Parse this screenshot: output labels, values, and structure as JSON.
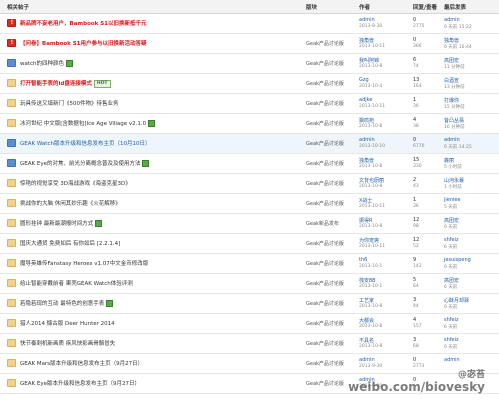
{
  "header": {
    "title": "相关帖子",
    "col_board": "版块",
    "col_author": "作者",
    "col_stats": "回复/查看",
    "col_last": "最后发表"
  },
  "rows": [
    {
      "title": "新品牌不妄老用户，Bambook S1以旧换新抵千元",
      "style": "red",
      "icon": "alert",
      "badge": "",
      "board": "",
      "author": "admin",
      "adate": "2013-8-30",
      "replies": "0",
      "views": "2775",
      "lastuser": "admin",
      "lasttime": "6 天前 15:22"
    },
    {
      "title": "【问卷】Bambook S1用户参与以旧换新活动答疑",
      "style": "red",
      "icon": "alert",
      "badge": "",
      "board": "Geak产品讨论版",
      "author": "独角兽",
      "adate": "2013-10-11",
      "replies": "0",
      "views": "366",
      "lastuser": "独角兽",
      "lasttime": "6 天前 16:44"
    },
    {
      "title": "watch的四种颜色",
      "style": "",
      "icon": "blue",
      "badge": "sq",
      "board": "Geak产品讨论版",
      "author": "我叫阿锦",
      "adate": "2013-10-8",
      "replies": "6",
      "views": "74",
      "lastuser": "高团宏",
      "lasttime": "11 分钟前"
    },
    {
      "title": "打开智能手表的id盘连接模式",
      "style": "red",
      "icon": "folder",
      "badge": "hot",
      "board": "Geak产品讨论版",
      "author": "Gzg",
      "adate": "2013-10-4",
      "replies": "13",
      "views": "164",
      "lastuser": "白酒宣",
      "lasttime": "13 分钟前"
    },
    {
      "title": "玩具传送又填新门《500件物》待售业务",
      "style": "",
      "icon": "folder",
      "badge": "",
      "board": "Geak产品讨论版",
      "author": "adjke",
      "adate": "2013-10-11",
      "replies": "1",
      "views": "36",
      "lastuser": "打爆你",
      "lasttime": "15 分钟前"
    },
    {
      "title": "冰河世纪 中文版[含数据包]Ice Age Village v2.1.0",
      "style": "",
      "icon": "folder",
      "badge": "sq",
      "board": "Geak产品讨论版",
      "author": "飘鸣宛",
      "adate": "2013-10-8",
      "replies": "4",
      "views": "38",
      "lastuser": "昔凸丛翡",
      "lasttime": "16 分钟前"
    },
    {
      "title": "GEAK Watch版本升级和信息发布主页（10月10日）",
      "style": "blue",
      "icon": "blue",
      "badge": "",
      "board": "Geak产品讨论版",
      "author": "admin",
      "adate": "2013-10-10",
      "replies": "0",
      "views": "6770",
      "lastuser": "admin",
      "lasttime": "6 天前 14:25"
    },
    {
      "title": "GEAK Eye的对焦、前光分离概念普及及使用方法",
      "style": "",
      "icon": "blue",
      "badge": "sq",
      "board": "Geak产品讨论版",
      "author": "独角兽",
      "adate": "2013-10-8",
      "replies": "15",
      "views": "330",
      "lastuser": "森丽",
      "lasttime": "5 小时前"
    },
    {
      "title": "惊艳的视觉享受 3D海战游戏《海盗克星3D》",
      "style": "",
      "icon": "folder",
      "badge": "",
      "board": "Geak产品讨论版",
      "author": "文背也厨丽",
      "adate": "2013-10-8",
      "replies": "2",
      "views": "43",
      "lastuser": "山河永暴",
      "lasttime": "1 小时前"
    },
    {
      "title": "挑战你的大脑 休闲其妙乐趣《火花解移》",
      "style": "",
      "icon": "folder",
      "badge": "",
      "board": "Geak产品讨论版",
      "author": "X战士",
      "adate": "2013-10-11",
      "replies": "1",
      "views": "36",
      "lastuser": "jieniee",
      "lasttime": "5 天前"
    },
    {
      "title": "圆形挂钟 最新最潮报时间方式",
      "style": "",
      "icon": "folder",
      "badge": "sq",
      "board": "Geak新品发布",
      "author": "振得R",
      "adate": "2013-10-8",
      "replies": "12",
      "views": "98",
      "lastuser": "高团宏",
      "lasttime": "6 天前"
    },
    {
      "title": "国庆大通货 免费如后 有你如后 [2.2.1.4]",
      "style": "",
      "icon": "folder",
      "badge": "",
      "board": "Geak产品讨论版",
      "author": "为你宠爽",
      "adate": "2013-10-11",
      "replies": "12",
      "views": "52",
      "lastuser": "shfeiz",
      "lasttime": "6 天前"
    },
    {
      "title": "魔导英雄传Fanstasy Heroes v1.07中文金币修改版",
      "style": "",
      "icon": "folder",
      "badge": "",
      "board": "Geak产品讨论版",
      "author": "th6",
      "adate": "2013-10-1",
      "replies": "9",
      "views": "142",
      "lastuser": "jesuispeng",
      "lasttime": "6 天前"
    },
    {
      "title": "给止智能穿戴前者 果壳GEAK Watch体验评测",
      "style": "",
      "icon": "folder",
      "badge": "",
      "board": "Geak产品讨论版",
      "author": "栈安8B",
      "adate": "2013-10-1",
      "replies": "5",
      "views": "64",
      "lastuser": "高团宏",
      "lasttime": "6 天前"
    },
    {
      "title": "若隐若现的互动 最特色的创意手表",
      "style": "",
      "icon": "folder",
      "badge": "sq",
      "board": "Geak产品讨论版",
      "author": "工艺家",
      "adate": "2013-10-8",
      "replies": "3",
      "views": "44",
      "lastuser": "心酥月却驿",
      "lasttime": "6 天前"
    },
    {
      "title": "猎人2014 慷古版 Deer Hunter 2014",
      "style": "",
      "icon": "folder",
      "badge": "",
      "board": "Geak产品讨论版",
      "author": "大都会",
      "adate": "2013-10-8",
      "replies": "4",
      "views": "157",
      "lastuser": "shfeiz",
      "lasttime": "6 天前"
    },
    {
      "title": "快节奏刺机新画质 疾风快影画骨骼冒失",
      "style": "",
      "icon": "folder",
      "badge": "",
      "board": "Geak产品讨论版",
      "author": "不具名",
      "adate": "2013-10-8",
      "replies": "3",
      "views": "68",
      "lastuser": "shfeiz",
      "lasttime": "6 天前"
    },
    {
      "title": "GEAK Mars版本升级和信息发布主页（9月27日）",
      "style": "",
      "icon": "folder",
      "badge": "",
      "board": "Geak产品讨论版",
      "author": "admin",
      "adate": "2013-9-30",
      "replies": "0",
      "views": "2773",
      "lastuser": "admin",
      "lasttime": ""
    },
    {
      "title": "GEAK Eye版本升级和信息发布主页（9月27日）",
      "style": "",
      "icon": "folder",
      "badge": "",
      "board": "Geak产品讨论版",
      "author": "admin",
      "adate": "2013-9-30",
      "replies": "0",
      "views": "",
      "lastuser": "",
      "lasttime": ""
    }
  ],
  "watermark": {
    "user": "@宓苔",
    "text": "weibo.com/biovesky"
  }
}
